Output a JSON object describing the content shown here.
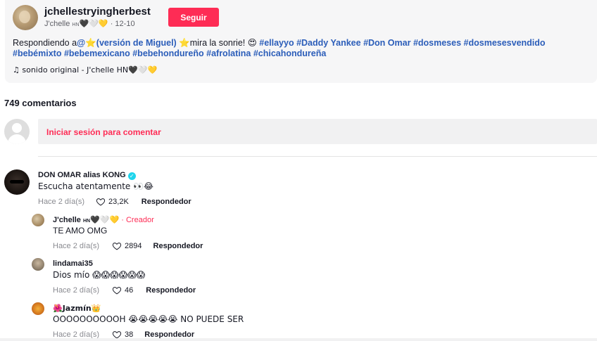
{
  "post": {
    "username": "jchellestryingherbest",
    "display_name": "J'chelle",
    "display_suffix": "HN",
    "display_emojis": "🖤🤍💛",
    "separator": "·",
    "date": "12-10",
    "follow_label": "Seguir",
    "caption": {
      "prefix": "Respondiendo a",
      "mention": "@⭐(versión de Miguel) ⭐",
      "text": "mira la sonrie! 😍",
      "hashtags": [
        "#ellayyo",
        "#Daddy Yankee",
        "#Don Omar",
        "#dosmeses",
        "#dosmesesvendido",
        "#bebémixto",
        "#bebemexicano",
        "#bebehondureño",
        "#afrolatina",
        "#chicahondureña"
      ]
    },
    "music": "♫ sonido original - J'chelle HN🖤🤍💛"
  },
  "comments_section": {
    "count_label": "749 comentarios",
    "login_prompt": "Iniciar sesión para comentar"
  },
  "comments": [
    {
      "author": "DON OMAR alias KONG",
      "verified": true,
      "text": "Escucha atentamente 👀😂",
      "date": "Hace 2 día(s)",
      "likes": "23,2K",
      "reply_label": "Respondedor"
    }
  ],
  "replies": [
    {
      "author": "J'chelle",
      "author_suffix": "HN",
      "author_emojis": "🖤🤍💛",
      "badge": "· Creador",
      "text": "TE AMO OMG",
      "date": "Hace 2 día(s)",
      "likes": "2894",
      "reply_label": "Respondedor"
    },
    {
      "author": "lindamai35",
      "text": "Dios mío 😱😱😱😱😱😱",
      "date": "Hace 2 día(s)",
      "likes": "46",
      "reply_label": "Respondedor"
    },
    {
      "author": "🌺Jazmín👑",
      "text": "OOOOOOOOOOH 😭😭😭😭😭 NO PUEDE SER",
      "date": "Hace 2 día(s)",
      "likes": "38",
      "reply_label": "Respondedor"
    }
  ],
  "colors": {
    "accent": "#fe2c55",
    "hashtag": "#2b5db9",
    "muted": "#8a8b91"
  }
}
